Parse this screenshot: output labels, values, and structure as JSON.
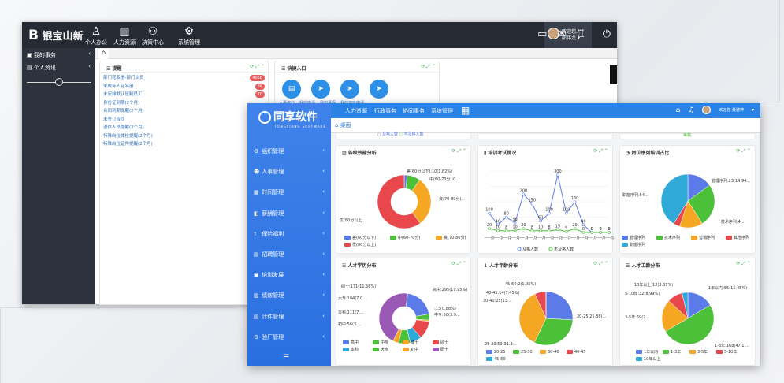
{
  "colors": {
    "blue": "#5b7be8",
    "green": "#4cc038",
    "orange": "#f5a623",
    "red": "#e8474c",
    "cyan": "#2ea9d8",
    "purple": "#9b59b6"
  },
  "winA": {
    "logo": "银宝山新",
    "nav": [
      {
        "icon": "person-icon",
        "label": "个人办公"
      },
      {
        "icon": "hr-icon",
        "label": "人力资源"
      },
      {
        "icon": "people-icon",
        "label": "决策中心"
      },
      {
        "icon": "gear-icon",
        "label": "系统管理"
      }
    ],
    "user_line1": "欢迎您,",
    "user_line2": "邵伟龙",
    "sidebar": [
      {
        "label": "我的事务"
      },
      {
        "label": "个人资讯"
      }
    ],
    "remind": {
      "title": "提醒",
      "items": [
        {
          "label": "部门花名册-部门文员",
          "badge": "4068"
        },
        {
          "label": "未成年人花名册",
          "badge": "66"
        },
        {
          "label": "未安排默认班制员工",
          "badge": "70"
        },
        {
          "label": "身份证到期(2个月)",
          "badge": ""
        },
        {
          "label": "合同到期提醒(2个月)",
          "badge": ""
        },
        {
          "label": "未签订合同",
          "badge": ""
        },
        {
          "label": "退休人员提醒(2个月)",
          "badge": ""
        },
        {
          "label": "特殊岗位体检提醒(2个月)",
          "badge": ""
        },
        {
          "label": "特殊岗位证件提醒(2个月)",
          "badge": ""
        }
      ]
    },
    "quick": {
      "title": "快捷入口",
      "items": [
        "人事资料",
        "我的申请",
        "我的请假",
        "我的加班申请"
      ]
    }
  },
  "winB": {
    "logo": "同享软件",
    "logo_sub": "TONGXIANG SOFTWARE",
    "nav": [
      "人力资源",
      "行政事务",
      "协同事务",
      "系统管理"
    ],
    "user": "欢迎您 聂德坤",
    "tab": "桌面",
    "sidebar": [
      "组织管理",
      "人事管理",
      "时间管理",
      "薪酬管理",
      "保险福利",
      "招聘管理",
      "培训发展",
      "绩效管理",
      "计件管理",
      "验厂管理"
    ],
    "top_partial": {
      "legend": [
        "及格人数",
        "不及格人数"
      ],
      "partial": "每格"
    }
  },
  "chart_data": [
    {
      "type": "pie",
      "title": "各级效能分析",
      "donut": true,
      "labels": [
        "差(60分以下)",
        "中(60-70分)",
        "良(70-80分)",
        "优(80分以上)"
      ],
      "values": [
        1.82,
        8,
        30,
        60.18
      ],
      "data_labels": [
        "差(60分以下):10(1.82%)",
        "中(60-70分):0...",
        "良(70-80分)...",
        "优(80分以上..."
      ]
    },
    {
      "type": "line",
      "title": "培训考试情况",
      "series": [
        {
          "name": "及格人数",
          "values": [
            100,
            40,
            80,
            50,
            200,
            150,
            60,
            100,
            300,
            100,
            160,
            40,
            0,
            0,
            0
          ]
        },
        {
          "name": "不及格人数",
          "values": [
            20,
            10,
            8,
            10,
            20,
            8,
            10,
            8,
            15,
            5,
            20,
            0,
            0,
            0,
            0
          ]
        }
      ],
      "data_labels_a": [
        "100",
        "40",
        "80",
        "50",
        "200",
        "150",
        "60",
        "100",
        "300",
        "100",
        "160",
        "40",
        "0",
        "0",
        "0"
      ],
      "data_labels_b": [
        "20",
        "10",
        "8",
        "10",
        "20",
        "8",
        "10",
        "8",
        "15",
        "5",
        "20",
        "0",
        "0",
        "0",
        "0"
      ],
      "x_tick": "一一月"
    },
    {
      "type": "pie",
      "title": "岗位序列培训占比",
      "labels": [
        "管理序列",
        "技术序列",
        "营销序列",
        "其他序列",
        "职能序列"
      ],
      "values": [
        14.94,
        26,
        14,
        4,
        41.06
      ],
      "data_labels": [
        "管理序列:23(14.94...",
        "技术序列:4...",
        "职能序列:54..."
      ]
    },
    {
      "type": "pie",
      "title": "人才学历分布",
      "donut": true,
      "labels": [
        "高中",
        "中专",
        "博士",
        "硕士",
        "本科",
        "大专",
        "初中",
        "研士"
      ],
      "values": [
        19.95,
        3.9,
        0.88,
        11.56,
        7.5,
        7.5,
        3.8,
        44.91
      ],
      "data_labels": [
        "硕士:171(11.56%)",
        "高中:295(19.95%)",
        "大专:104(7.0...",
        "本科:111(7....",
        "初中:56(3....",
        ":13(0.88%)",
        "中专:58(3.9..."
      ]
    },
    {
      "type": "pie",
      "title": "人才年龄分布",
      "labels": [
        "20-25",
        "25-30",
        "30-40",
        "40-45",
        "45-60"
      ],
      "values": [
        25.88,
        31.3,
        36,
        6.76,
        0.06
      ],
      "data_labels": [
        "45-60:2(1.06%)",
        "40-45:14(7.45%)",
        "30-40:25(13...",
        "20-25:25.88(...",
        "25-30:59(31.3..."
      ]
    },
    {
      "type": "pie",
      "title": "人才工龄分布",
      "labels": [
        "1年以内",
        "1-3年",
        "3-5年",
        "5-10年",
        "10年以上"
      ],
      "values": [
        15.45,
        47.1,
        19,
        8.99,
        3.37
      ],
      "data_labels": [
        "10年以上:12(3.37%)",
        "1年以内:55(15.45%)",
        "5-10年:32(8.99%)",
        "3-5年:69(2...",
        "1-3年:168(47.1..."
      ]
    }
  ]
}
